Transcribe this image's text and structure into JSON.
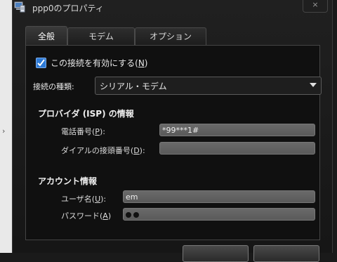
{
  "window": {
    "title": "ppp0のプロパティ",
    "close_label": "×"
  },
  "tabs": [
    {
      "label": "全般",
      "active": true
    },
    {
      "label": "モデム",
      "active": false
    },
    {
      "label": "オプション",
      "active": false
    }
  ],
  "general": {
    "enable_checkbox": {
      "label": "この接続を有効にする(",
      "mnemonic": "N",
      "suffix": ")",
      "checked": true
    },
    "connection_type": {
      "label": "接続の種類:",
      "value": "シリアル・モデム"
    },
    "isp_section": {
      "title": "プロバイダ (ISP) の情報",
      "phone": {
        "label": "電話番号(",
        "mnemonic": "P",
        "suffix": "):",
        "value": "*99***1#"
      },
      "prefix": {
        "label": "ダイアルの接頭番号(",
        "mnemonic": "D",
        "suffix": "):",
        "value": ""
      }
    },
    "account_section": {
      "title": "アカウント情報",
      "username": {
        "label": "ユーザ名(",
        "mnemonic": "U",
        "suffix": "):",
        "value": "em"
      },
      "password": {
        "label": "パスワード(",
        "mnemonic": "A",
        "suffix": ")",
        "masked_length": 2
      }
    }
  },
  "colors": {
    "accent": "#2d7ad6",
    "dialog_bg": "#1a1a1a",
    "field_bg": "#666666"
  }
}
